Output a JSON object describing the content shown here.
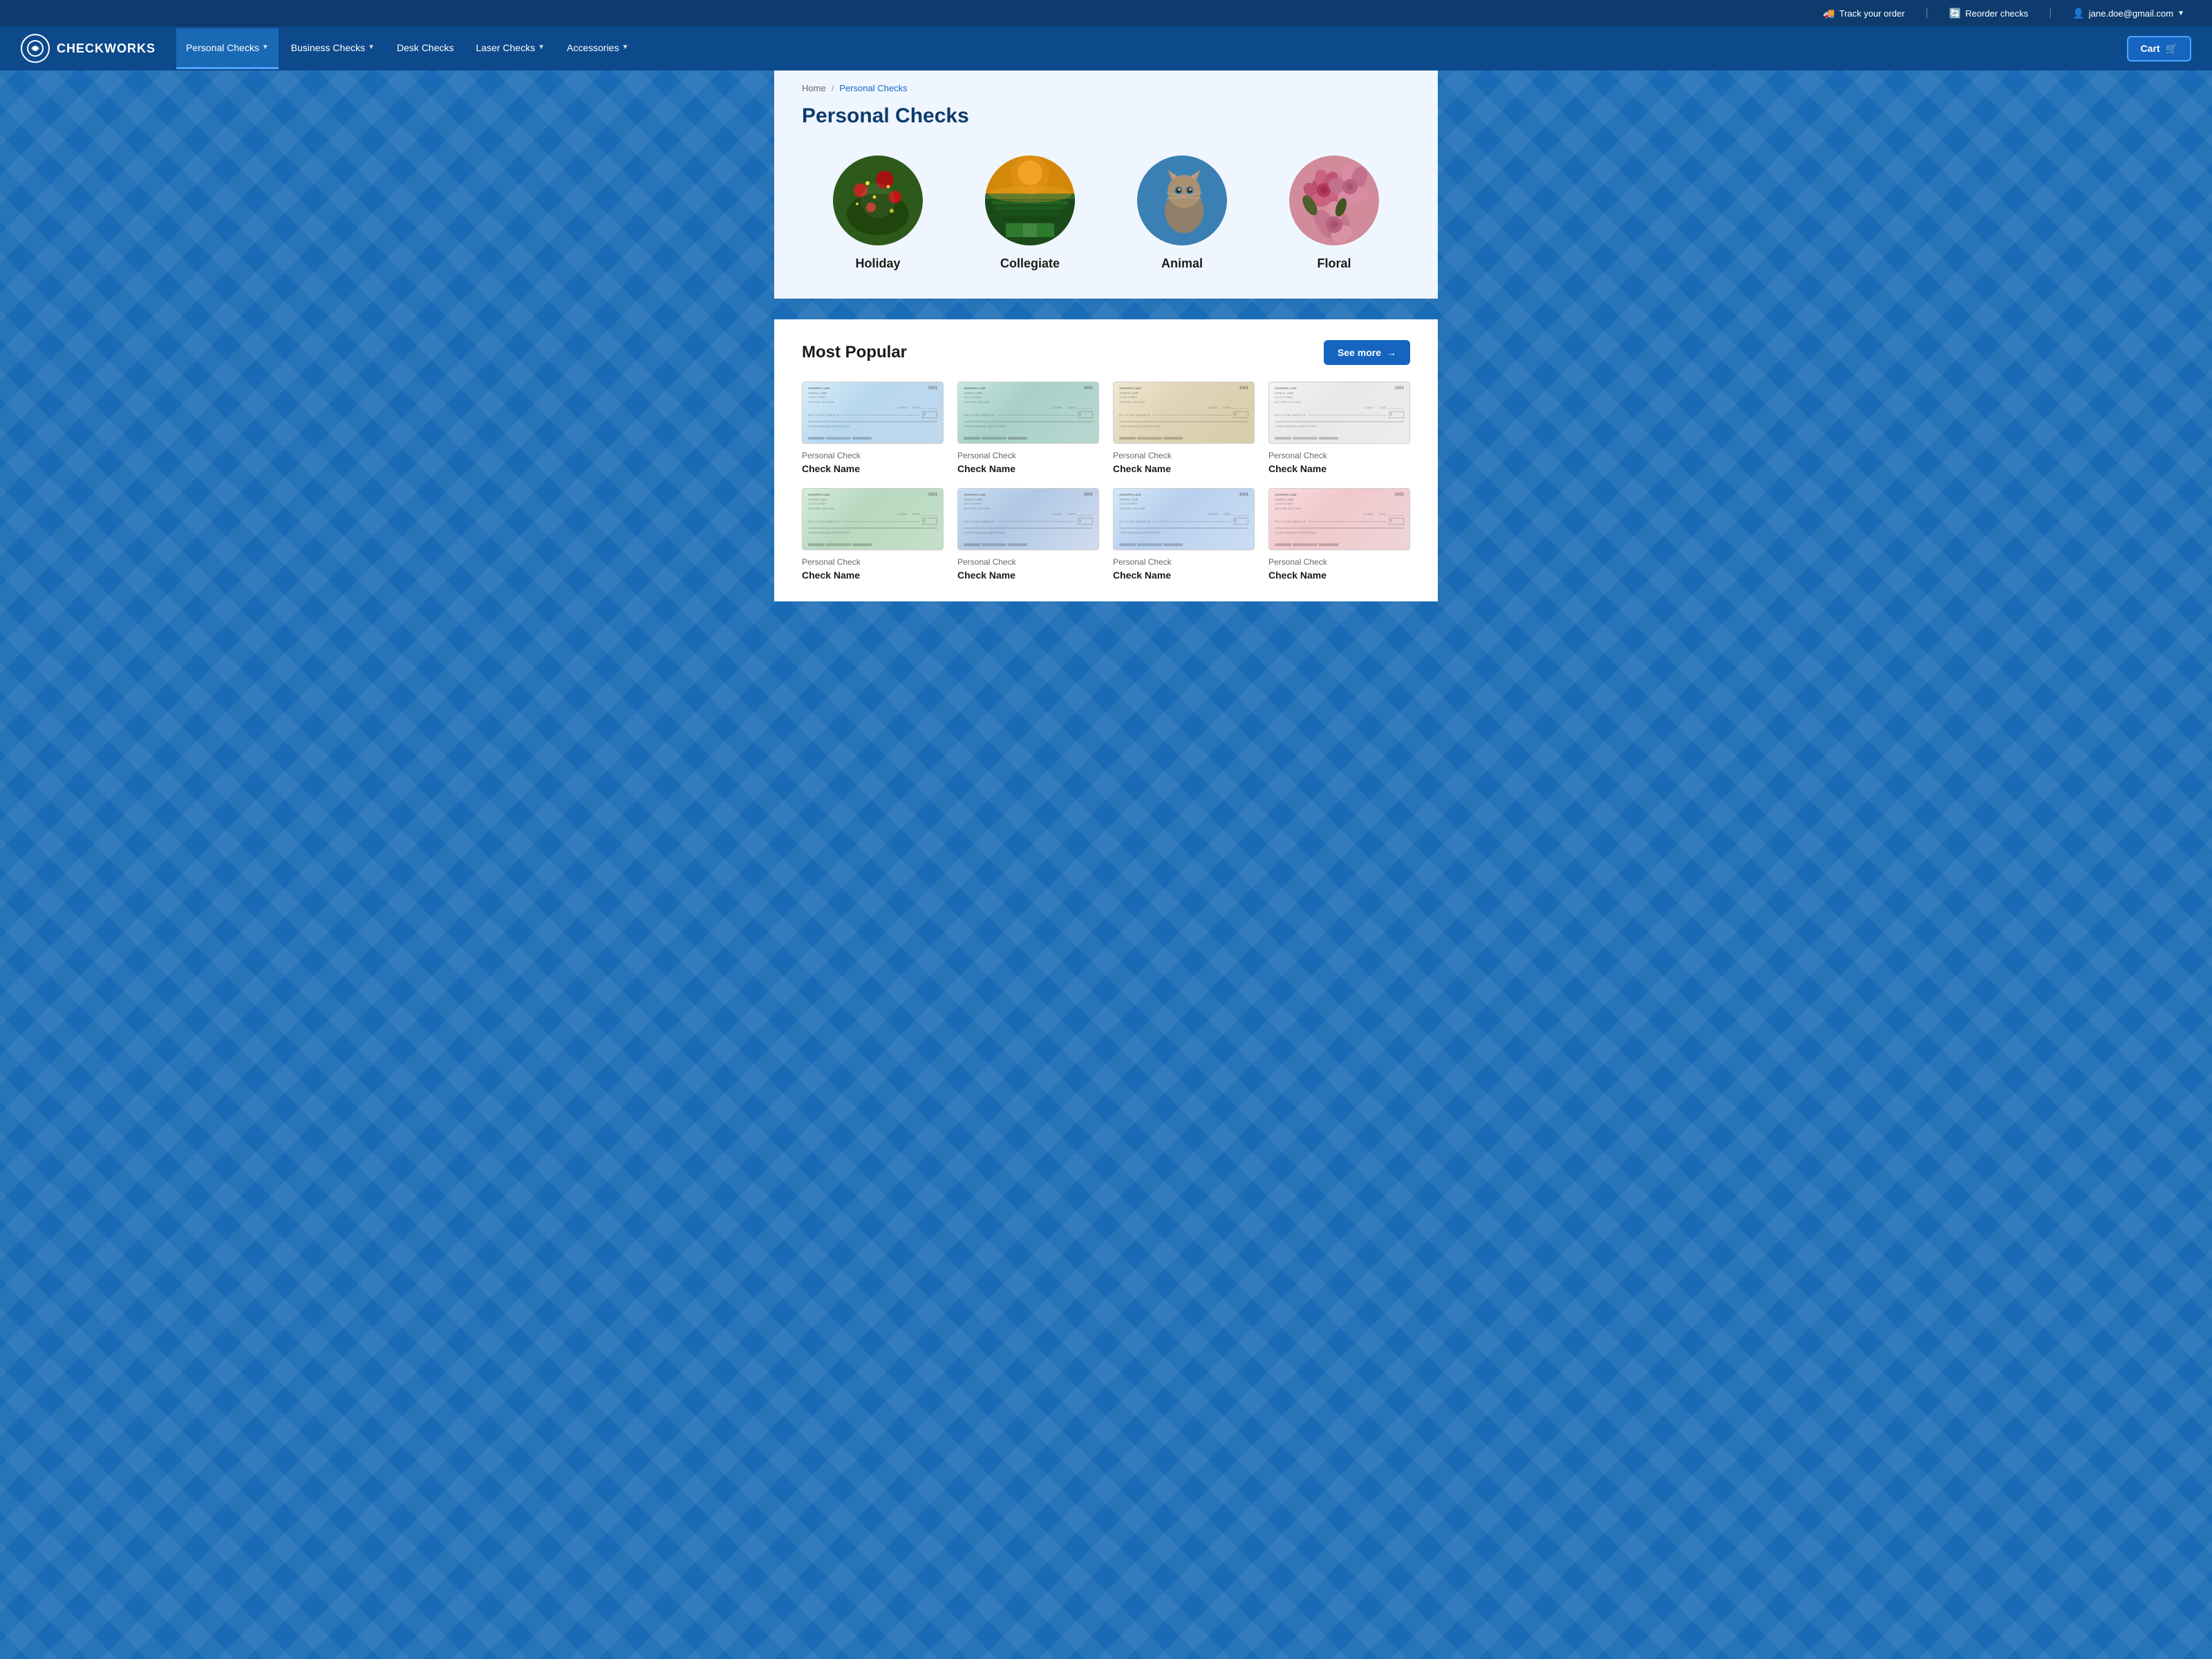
{
  "topBar": {
    "trackOrder": "Track your order",
    "reorderChecks": "Reorder checks",
    "userEmail": "jane.doe@gmail.com",
    "trackIcon": "🚚",
    "reorderIcon": "🔄",
    "userIcon": "👤"
  },
  "nav": {
    "logo": "CHECKWORKS",
    "items": [
      {
        "id": "personal",
        "label": "Personal Checks",
        "hasDropdown": true,
        "active": true
      },
      {
        "id": "business",
        "label": "Business Checks",
        "hasDropdown": true,
        "active": false
      },
      {
        "id": "desk",
        "label": "Desk Checks",
        "hasDropdown": false,
        "active": false
      },
      {
        "id": "laser",
        "label": "Laser Checks",
        "hasDropdown": true,
        "active": false
      },
      {
        "id": "accessories",
        "label": "Accessories",
        "hasDropdown": true,
        "active": false
      }
    ],
    "cartLabel": "Cart"
  },
  "breadcrumb": {
    "home": "Home",
    "separator": "/",
    "current": "Personal Checks"
  },
  "pageTitle": "Personal Checks",
  "categories": [
    {
      "id": "holiday",
      "label": "Holiday",
      "type": "holiday"
    },
    {
      "id": "collegiate",
      "label": "Collegiate",
      "type": "collegiate"
    },
    {
      "id": "animal",
      "label": "Animal",
      "type": "animal"
    },
    {
      "id": "floral",
      "label": "Floral",
      "type": "floral"
    }
  ],
  "mostPopular": {
    "title": "Most Popular",
    "seeMoreLabel": "See more",
    "products": [
      {
        "id": "p1",
        "subtitle": "Personal Check",
        "name": "Check Name",
        "style": "check-blue"
      },
      {
        "id": "p2",
        "subtitle": "Personal Check",
        "name": "Check Name",
        "style": "check-teal"
      },
      {
        "id": "p3",
        "subtitle": "Personal Check",
        "name": "Check Name",
        "style": "check-beige"
      },
      {
        "id": "p4",
        "subtitle": "Personal Check",
        "name": "Check Name",
        "style": "check-white"
      },
      {
        "id": "p5",
        "subtitle": "Personal Check",
        "name": "Check Name",
        "style": "check-green"
      },
      {
        "id": "p6",
        "subtitle": "Personal Check",
        "name": "Check Name",
        "style": "check-scene"
      },
      {
        "id": "p7",
        "subtitle": "Personal Check",
        "name": "Check Name",
        "style": "check-sky"
      },
      {
        "id": "p8",
        "subtitle": "Personal Check",
        "name": "Check Name",
        "style": "check-pink"
      }
    ]
  }
}
